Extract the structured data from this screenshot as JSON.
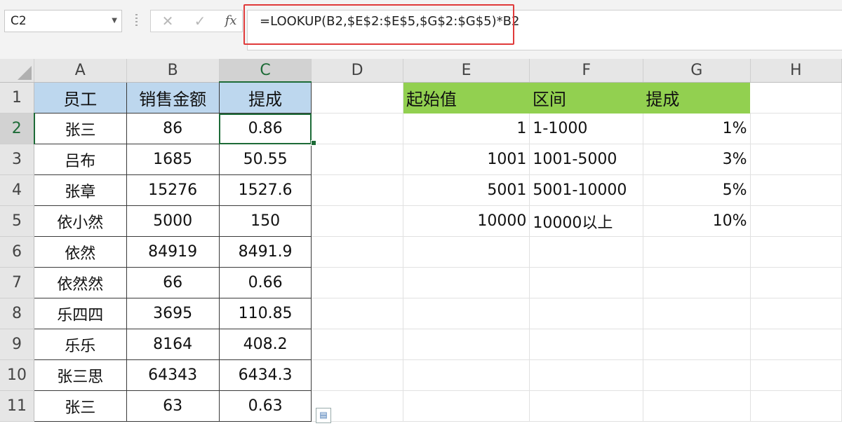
{
  "formula_bar": {
    "name_box": "C2",
    "formula": "=LOOKUP(B2,$E$2:$E$5,$G$2:$G$5)*B2",
    "cancel_icon": "✕",
    "confirm_icon": "✓",
    "fx_label": "fx"
  },
  "columns": [
    "A",
    "B",
    "C",
    "D",
    "E",
    "F",
    "G",
    "H"
  ],
  "rows": [
    "1",
    "2",
    "3",
    "4",
    "5",
    "6",
    "7",
    "8",
    "9",
    "10",
    "11"
  ],
  "left_table": {
    "headers": [
      "员工",
      "销售金额",
      "提成"
    ],
    "data": [
      [
        "张三",
        "86",
        "0.86"
      ],
      [
        "吕布",
        "1685",
        "50.55"
      ],
      [
        "张章",
        "15276",
        "1527.6"
      ],
      [
        "依小然",
        "5000",
        "150"
      ],
      [
        "依然",
        "84919",
        "8491.9"
      ],
      [
        "依然然",
        "66",
        "0.66"
      ],
      [
        "乐四四",
        "3695",
        "110.85"
      ],
      [
        "乐乐",
        "8164",
        "408.2"
      ],
      [
        "张三思",
        "64343",
        "6434.3"
      ],
      [
        "张三",
        "63",
        "0.63"
      ]
    ]
  },
  "right_table": {
    "headers": [
      "起始值",
      "区间",
      "提成"
    ],
    "data": [
      [
        "1",
        "1-1000",
        "1%"
      ],
      [
        "1001",
        "1001-5000",
        "3%"
      ],
      [
        "5001",
        "5001-10000",
        "5%"
      ],
      [
        "10000",
        "10000以上",
        "10%"
      ]
    ]
  },
  "colors": {
    "header_blue": "#bdd7ee",
    "header_green": "#92d050",
    "selection_green": "#1d6b37",
    "highlight_red": "#e03a3a"
  }
}
